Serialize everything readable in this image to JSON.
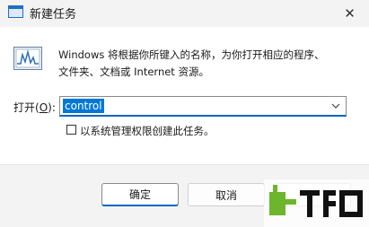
{
  "window": {
    "title": "新建任务",
    "close_glyph": "✕"
  },
  "description": {
    "line1": "Windows 将根据你所键入的名称，为你打开相应的程序、",
    "line2": "文件夹、文档或 Internet 资源。"
  },
  "open": {
    "label_prefix": "打开(",
    "label_accel": "O",
    "label_suffix": "):",
    "value": "control"
  },
  "admin_checkbox": {
    "label": "以系统管理权限创建此任务。",
    "checked": false
  },
  "buttons": {
    "ok": "确定",
    "cancel": "取消",
    "browse": ""
  },
  "colors": {
    "accent": "#0067c0",
    "selection": "#0078d7"
  },
  "icons": {
    "title": "task-window-icon",
    "app": "monitor-graph-icon",
    "dropdown": "chevron-down-icon"
  }
}
